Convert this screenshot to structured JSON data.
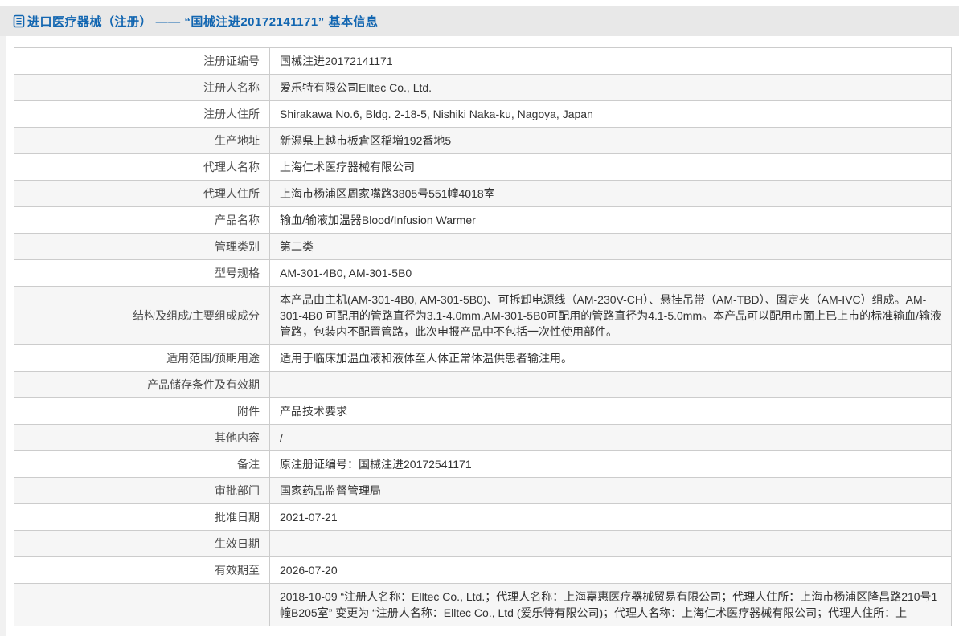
{
  "header": {
    "title": "进口医疗器械（注册） —— “国械注进20172141171” 基本信息",
    "icon": "document-icon",
    "title_color": "#1266b1",
    "bar_background": "#e8e8e8"
  },
  "colors": {
    "border": "#cccccc",
    "stripe_row": "#f6f6f6",
    "text": "#333333"
  },
  "table": {
    "rows": [
      {
        "label": "注册证编号",
        "value": "国械注进20172141171"
      },
      {
        "label": "注册人名称",
        "value": "爱乐特有限公司Elltec Co., Ltd."
      },
      {
        "label": "注册人住所",
        "value": "Shirakawa No.6, Bldg. 2-18-5, Nishiki Naka-ku, Nagoya, Japan"
      },
      {
        "label": "生产地址",
        "value": "新潟県上越市板倉区稲増192番地5"
      },
      {
        "label": "代理人名称",
        "value": "上海仁术医疗器械有限公司"
      },
      {
        "label": "代理人住所",
        "value": "上海市杨浦区周家嘴路3805号551幢4018室"
      },
      {
        "label": "产品名称",
        "value": "输血/输液加温器Blood/Infusion Warmer"
      },
      {
        "label": "管理类别",
        "value": "第二类"
      },
      {
        "label": "型号规格",
        "value": "AM-301-4B0, AM-301-5B0"
      },
      {
        "label": "结构及组成/主要组成成分",
        "value": "本产品由主机(AM-301-4B0, AM-301-5B0)、可拆卸电源线（AM-230V-CH）、悬挂吊带（AM-TBD）、固定夹（AM-IVC）组成。AM-301-4B0 可配用的管路直径为3.1-4.0mm,AM-301-5B0可配用的管路直径为4.1-5.0mm。本产品可以配用市面上已上市的标准输血/输液管路，包装内不配置管路，此次申报产品中不包括一次性使用部件。"
      },
      {
        "label": "适用范围/预期用途",
        "value": "适用于临床加温血液和液体至人体正常体温供患者输注用。"
      },
      {
        "label": "产品储存条件及有效期",
        "value": ""
      },
      {
        "label": "附件",
        "value": "产品技术要求"
      },
      {
        "label": "其他内容",
        "value": "/"
      },
      {
        "label": "备注",
        "value": "原注册证编号：国械注进20172541171"
      },
      {
        "label": "审批部门",
        "value": "国家药品监督管理局"
      },
      {
        "label": "批准日期",
        "value": "2021-07-21"
      },
      {
        "label": "生效日期",
        "value": ""
      },
      {
        "label": "有效期至",
        "value": "2026-07-20"
      },
      {
        "label": "",
        "value": "2018-10-09 “注册人名称：Elltec Co., Ltd.；代理人名称：上海嘉惠医疗器械贸易有限公司；代理人住所：上海市杨浦区隆昌路210号1幢B205室” 变更为 “注册人名称：Elltec Co., Ltd (爱乐特有限公司)；代理人名称：上海仁术医疗器械有限公司；代理人住所：上"
      }
    ]
  }
}
